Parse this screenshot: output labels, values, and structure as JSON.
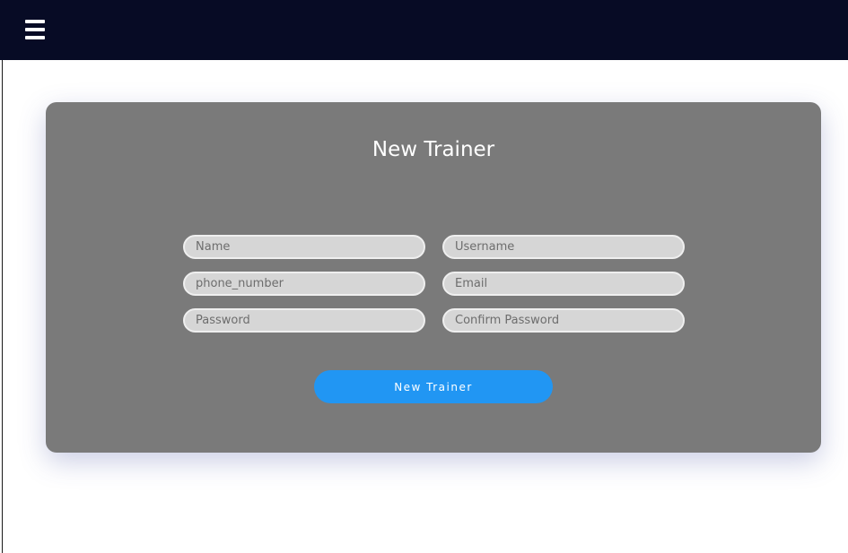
{
  "header": {
    "menu_icon": "hamburger-menu-icon"
  },
  "form": {
    "title": "New Trainer",
    "fields": {
      "name": {
        "placeholder": "Name",
        "value": ""
      },
      "username": {
        "placeholder": "Username",
        "value": ""
      },
      "phone_number": {
        "placeholder": "phone_number",
        "value": ""
      },
      "email": {
        "placeholder": "Email",
        "value": ""
      },
      "password": {
        "placeholder": "Password",
        "value": ""
      },
      "confirm_password": {
        "placeholder": "Confirm Password",
        "value": ""
      }
    },
    "submit_label": "New Trainer"
  },
  "colors": {
    "header_bg": "#070b25",
    "card_bg": "#7a7a7a",
    "field_bg": "#d6d6d6",
    "accent": "#2196f3"
  }
}
